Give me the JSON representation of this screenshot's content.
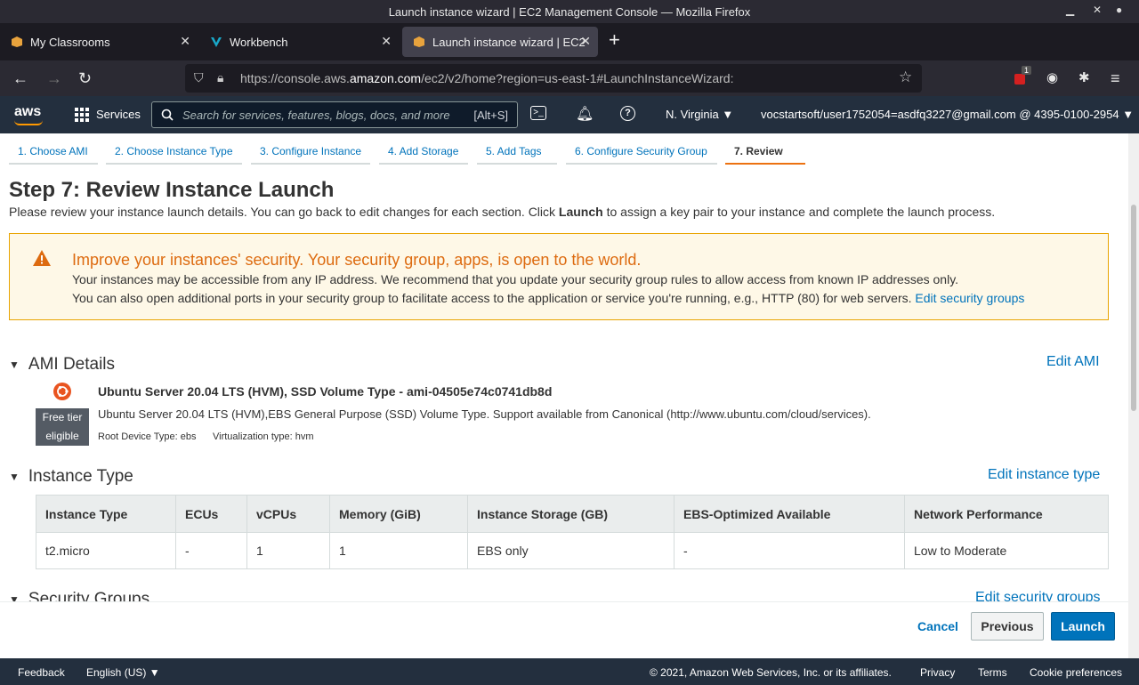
{
  "window": {
    "title": "Launch instance wizard | EC2 Management Console — Mozilla Firefox"
  },
  "browser": {
    "tabs": [
      {
        "label": "My Classrooms"
      },
      {
        "label": "Workbench"
      },
      {
        "label": "Launch instance wizard | EC2"
      }
    ],
    "url": {
      "prefix": "https://console.aws.",
      "host": "amazon.com",
      "path": "/ec2/v2/home?region=us-east-1#LaunchInstanceWizard:"
    },
    "extension_badge": "1"
  },
  "aws_nav": {
    "logo": "aws",
    "services": "Services",
    "search_placeholder": "Search for services, features, blogs, docs, and more",
    "search_shortcut": "[Alt+S]",
    "region": "N. Virginia",
    "account": "vocstartsoft/user1752054=asdfq3227@gmail.com @ 4395-0100-2954"
  },
  "wizard_steps": [
    {
      "label": "1. Choose AMI"
    },
    {
      "label": "2. Choose Instance Type"
    },
    {
      "label": "3. Configure Instance"
    },
    {
      "label": "4. Add Storage"
    },
    {
      "label": "5. Add Tags"
    },
    {
      "label": "6. Configure Security Group"
    },
    {
      "label": "7. Review"
    }
  ],
  "page": {
    "title": "Step 7: Review Instance Launch",
    "desc_before": "Please review your instance launch details. You can go back to edit changes for each section. Click ",
    "desc_bold": "Launch",
    "desc_after": " to assign a key pair to your instance and complete the launch process."
  },
  "alert": {
    "title": "Improve your instances' security. Your security group, apps, is open to the world.",
    "line1": "Your instances may be accessible from any IP address. We recommend that you update your security group rules to allow access from known IP addresses only.",
    "line2": "You can also open additional ports in your security group to facilitate access to the application or service you're running, e.g., HTTP (80) for web servers.",
    "link": "Edit security groups"
  },
  "ami": {
    "heading": "AMI Details",
    "edit": "Edit AMI",
    "badge_line1": "Free tier",
    "badge_line2": "eligible",
    "title": "Ubuntu Server 20.04 LTS (HVM), SSD Volume Type - ami-04505e74c0741db8d",
    "desc": "Ubuntu Server 20.04 LTS (HVM),EBS General Purpose (SSD) Volume Type. Support available from Canonical (http://www.ubuntu.com/cloud/services).",
    "root_device": "Root Device Type: ebs",
    "virt": "Virtualization type: hvm"
  },
  "instance_type": {
    "heading": "Instance Type",
    "edit": "Edit instance type",
    "columns": [
      "Instance Type",
      "ECUs",
      "vCPUs",
      "Memory (GiB)",
      "Instance Storage (GB)",
      "EBS-Optimized Available",
      "Network Performance"
    ],
    "rows": [
      [
        "t2.micro",
        "-",
        "1",
        "1",
        "EBS only",
        "-",
        "Low to Moderate"
      ]
    ]
  },
  "security_groups": {
    "heading": "Security Groups",
    "edit": "Edit security groups"
  },
  "actions": {
    "cancel": "Cancel",
    "previous": "Previous",
    "launch": "Launch"
  },
  "footer": {
    "feedback": "Feedback",
    "language": "English (US)",
    "copyright": "© 2021, Amazon Web Services, Inc. or its affiliates.",
    "privacy": "Privacy",
    "terms": "Terms",
    "cookies": "Cookie preferences"
  },
  "colors": {
    "aws_nav": "#232f3e",
    "link": "#0073bb",
    "accent": "#ec7211",
    "warning": "#dd6b10"
  }
}
